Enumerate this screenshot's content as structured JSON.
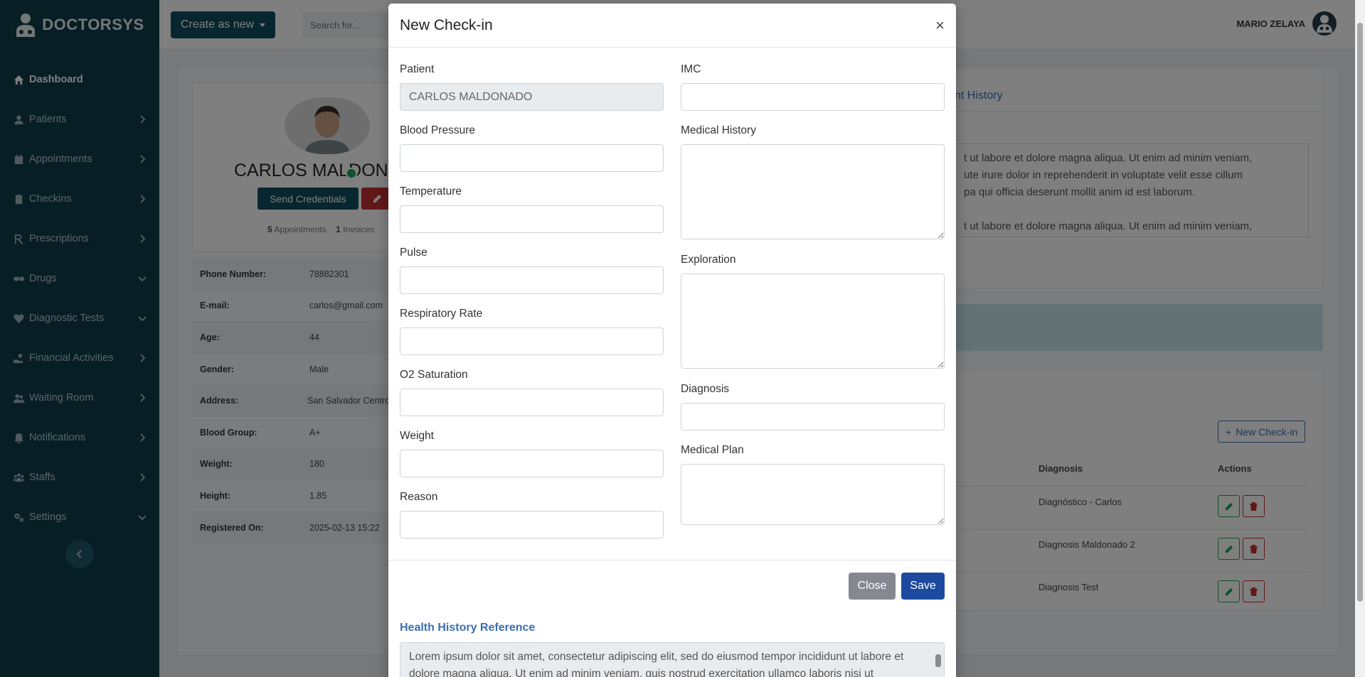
{
  "app": {
    "brand": "DOCTORSYS"
  },
  "sidebar": {
    "items": [
      {
        "label": "Dashboard",
        "icon": "home-icon",
        "active": true
      },
      {
        "label": "Patients",
        "icon": "user-icon",
        "chevron": "right"
      },
      {
        "label": "Appointments",
        "icon": "calendar-icon",
        "chevron": "right"
      },
      {
        "label": "Checkins",
        "icon": "clipboard-icon",
        "chevron": "right"
      },
      {
        "label": "Prescriptions",
        "icon": "prescription-icon",
        "chevron": "right"
      },
      {
        "label": "Drugs",
        "icon": "pills-icon",
        "chevron": "down"
      },
      {
        "label": "Diagnostic Tests",
        "icon": "heart-icon",
        "chevron": "down"
      },
      {
        "label": "Financial Activities",
        "icon": "hand-coin-icon",
        "chevron": "right"
      },
      {
        "label": "Waiting Room",
        "icon": "users-icon",
        "chevron": "right"
      },
      {
        "label": "Notifications",
        "icon": "bell-icon",
        "chevron": "right"
      },
      {
        "label": "Staffs",
        "icon": "group-icon",
        "chevron": "right"
      },
      {
        "label": "Settings",
        "icon": "gears-icon",
        "chevron": "down"
      }
    ]
  },
  "topbar": {
    "create_label": "Create as new",
    "search_placeholder": "Search for...",
    "user_name": "MARIO ZELAYA"
  },
  "background": {
    "patient_name": "CARLOS MALDONADO",
    "send_credentials": "Send Credentials",
    "stats": {
      "appointments_count": "5",
      "appointments_label": "Appointments",
      "invoices_count": "1",
      "invoices_label": "Invoices"
    },
    "info": [
      {
        "k": "Phone Number:",
        "v": "78882301"
      },
      {
        "k": "E-mail:",
        "v": "carlos@gmail.com"
      },
      {
        "k": "Age:",
        "v": "44"
      },
      {
        "k": "Gender:",
        "v": "Male"
      },
      {
        "k": "Address:",
        "v": "San Salvador Centro"
      },
      {
        "k": "Blood Group:",
        "v": "A+"
      },
      {
        "k": "Weight:",
        "v": "180"
      },
      {
        "k": "Height:",
        "v": "1.85"
      },
      {
        "k": "Registered On:",
        "v": "2025-02-13 15:22"
      }
    ],
    "tab_partial": "nt History",
    "textarea_line1": "t ut labore et dolore magna aliqua. Ut enim ad minim veniam,",
    "textarea_line2": "ute irure dolor in reprehenderit in voluptate velit esse cillum",
    "textarea_line3": "pa qui officia deserunt mollit anim id est laborum.",
    "textarea_line4": "t ut labore et dolore magna aliqua. Ut enim ad minim veniam,",
    "new_checkin": "New Check-in",
    "table": {
      "col_diagnosis": "Diagnosis",
      "col_actions": "Actions",
      "rows": [
        "Diagnóstico - Carlos",
        "Diagnosis Maldonado 2",
        "Diagnosis Test"
      ]
    }
  },
  "modal": {
    "title": "New Check-in",
    "close_symbol": "×",
    "fields": {
      "patient": {
        "label": "Patient",
        "value": "CARLOS MALDONADO"
      },
      "blood_pressure": {
        "label": "Blood Pressure",
        "value": ""
      },
      "temperature": {
        "label": "Temperature",
        "value": ""
      },
      "pulse": {
        "label": "Pulse",
        "value": ""
      },
      "respiratory_rate": {
        "label": "Respiratory Rate",
        "value": ""
      },
      "o2_saturation": {
        "label": "O2 Saturation",
        "value": ""
      },
      "weight": {
        "label": "Weight",
        "value": ""
      },
      "reason": {
        "label": "Reason",
        "value": ""
      },
      "imc": {
        "label": "IMC",
        "value": ""
      },
      "medical_history": {
        "label": "Medical History",
        "value": ""
      },
      "exploration": {
        "label": "Exploration",
        "value": ""
      },
      "diagnosis": {
        "label": "Diagnosis",
        "value": ""
      },
      "medical_plan": {
        "label": "Medical Plan",
        "value": ""
      }
    },
    "close_label": "Close",
    "save_label": "Save",
    "health_history_title": "Health History Reference",
    "health_history_text": "Lorem ipsum dolor sit amet, consectetur adipiscing elit, sed do eiusmod tempor incididunt ut labore et dolore magna aliqua. Ut enim ad minim veniam, quis nostrud exercitation ullamco laboris nisi ut"
  },
  "colors": {
    "sidebar": "#0e3d4a",
    "primary": "#1c4a9e",
    "link": "#3b6fb6",
    "danger": "#c53030",
    "success": "#1aa35a"
  }
}
